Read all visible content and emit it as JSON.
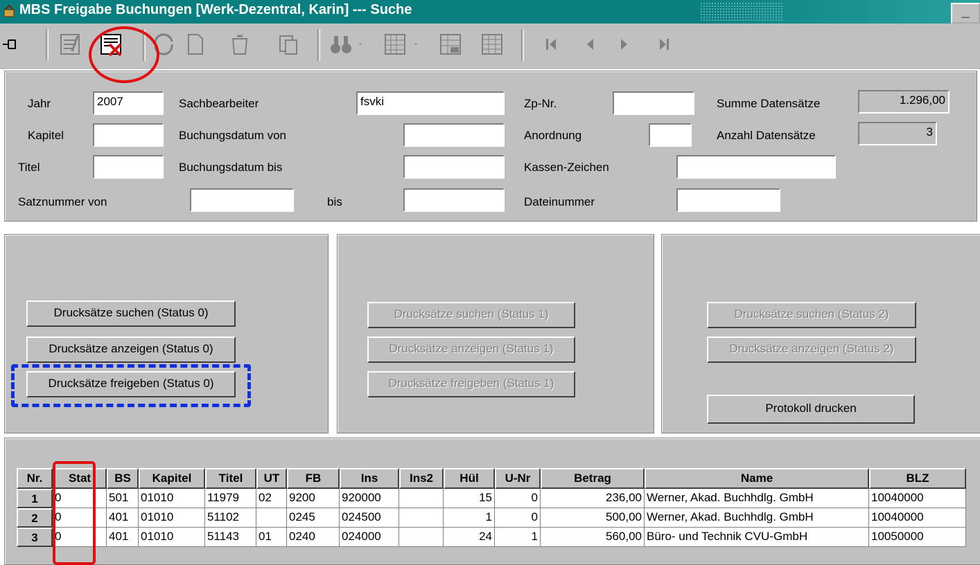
{
  "window": {
    "title": "MBS Freigabe Buchungen [Werk-Dezentral, Karin] --- Suche",
    "min_label": "_"
  },
  "toolbar": {
    "icons": [
      "pin-icon",
      "check-list-icon",
      "delete-record-icon",
      "refresh-icon",
      "new-document-icon",
      "trash-icon",
      "copy-document-icon",
      "binoculars-icon",
      "calendar-grid-icon",
      "table-edit-icon",
      "table-icon",
      "first-record-icon",
      "previous-record-icon",
      "next-record-icon",
      "last-record-icon"
    ]
  },
  "form": {
    "jahr": {
      "label": "Jahr",
      "value": "2007"
    },
    "sachbearbeiter": {
      "label": "Sachbearbeiter",
      "value": "fsvki"
    },
    "zp_nr": {
      "label": "Zp-Nr.",
      "value": ""
    },
    "summe": {
      "label": "Summe Datensätze",
      "value": "1.296,00"
    },
    "kapitel": {
      "label": "Kapitel",
      "value": ""
    },
    "buchungsdatum_von": {
      "label": "Buchungsdatum von",
      "value": ""
    },
    "anordnung": {
      "label": "Anordnung",
      "value": ""
    },
    "anzahl": {
      "label": "Anzahl Datensätze",
      "value": "3"
    },
    "titel": {
      "label": "Titel",
      "value": ""
    },
    "buchungsdatum_bis": {
      "label": "Buchungsdatum bis",
      "value": ""
    },
    "kassen_zeichen": {
      "label": "Kassen-Zeichen",
      "value": ""
    },
    "satznummer_von": {
      "label": "Satznummer von",
      "value": ""
    },
    "bis": {
      "label": "bis",
      "value": ""
    },
    "dateinummer": {
      "label": "Dateinummer",
      "value": ""
    }
  },
  "panels": {
    "status0": {
      "suchen": "Drucksätze suchen (Status 0)",
      "anzeigen": "Drucksätze anzeigen (Status 0)",
      "freigeben": "Drucksätze freigeben (Status 0)"
    },
    "status1": {
      "suchen": "Drucksätze suchen (Status 1)",
      "anzeigen": "Drucksätze anzeigen (Status 1)",
      "freigeben": "Drucksätze freigeben (Status 1)"
    },
    "status2": {
      "suchen": "Drucksätze suchen (Status 2)",
      "anzeigen": "Drucksätze anzeigen (Status 2)",
      "protokoll": "Protokoll drucken"
    }
  },
  "table": {
    "headers": [
      "Nr.",
      "Stat",
      "BS",
      "Kapitel",
      "Titel",
      "UT",
      "FB",
      "Ins",
      "Ins2",
      "Hül",
      "U-Nr",
      "Betrag",
      "Name",
      "BLZ"
    ],
    "rows": [
      [
        "1",
        "0",
        "501",
        "01010",
        "11979",
        "02",
        "9200",
        "920000",
        "",
        "15",
        "0",
        "236,00",
        "Werner, Akad. Buchhdlg. GmbH",
        "10040000"
      ],
      [
        "2",
        "0",
        "401",
        "01010",
        "51102",
        "",
        "0245",
        "024500",
        "",
        "1",
        "0",
        "500,00",
        "Werner, Akad. Buchhdlg. GmbH",
        "10040000"
      ],
      [
        "3",
        "0",
        "401",
        "01010",
        "51143",
        "01",
        "0240",
        "024000",
        "",
        "24",
        "1",
        "560,00",
        "Büro- und Technik CVU-GmbH",
        "10050000"
      ]
    ]
  },
  "colors": {
    "titlebar": "#0a7f7f",
    "face": "#c0c0c0",
    "annotation_red": "#e01010",
    "annotation_blue": "#1030e0"
  }
}
